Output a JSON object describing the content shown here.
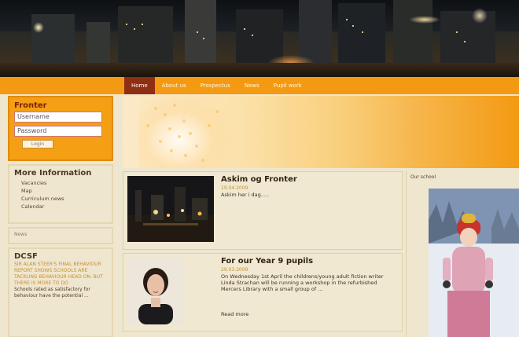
{
  "nav": {
    "items": [
      "Home",
      "About us",
      "Prospectus",
      "News",
      "Pupil work"
    ],
    "active_index": 0
  },
  "login": {
    "title": "Fronter",
    "username_placeholder": "Username",
    "password_placeholder": "Password",
    "login_label": "Login"
  },
  "more_info": {
    "title": "More Information",
    "links": [
      "Vacancies",
      "Map",
      "Curriculum news",
      "Calendar"
    ]
  },
  "news_box": {
    "label": "News"
  },
  "dcsf": {
    "title": "DCSF",
    "headline": "SIR ALAN STEER'S FINAL BEHAVIOUR REPORT SHOWS SCHOOLS ARE TACKLING BEHAVIOUR HEAD ON. BUT THERE IS MORE TO DO",
    "body": "Schools rated as satisfactory for behaviour have the potential ..."
  },
  "articles": [
    {
      "title": "Askim og Fronter",
      "date": "19.04.2009",
      "summary": "Askim her i dag.....",
      "more": ""
    },
    {
      "title": "For our Year 9 pupils",
      "date": "29.03.2009",
      "summary": "On Wednesday 1st April the childrens/young adult fiction writer Linda Strachan will be running a workshop in the refurbished Mercers Library with a small group of ...",
      "more": "Read more"
    }
  ],
  "right_column": {
    "label": "Our school"
  },
  "colors": {
    "accent": "#f39a12",
    "nav_active": "#8e2e12",
    "background": "#efe6cf"
  }
}
